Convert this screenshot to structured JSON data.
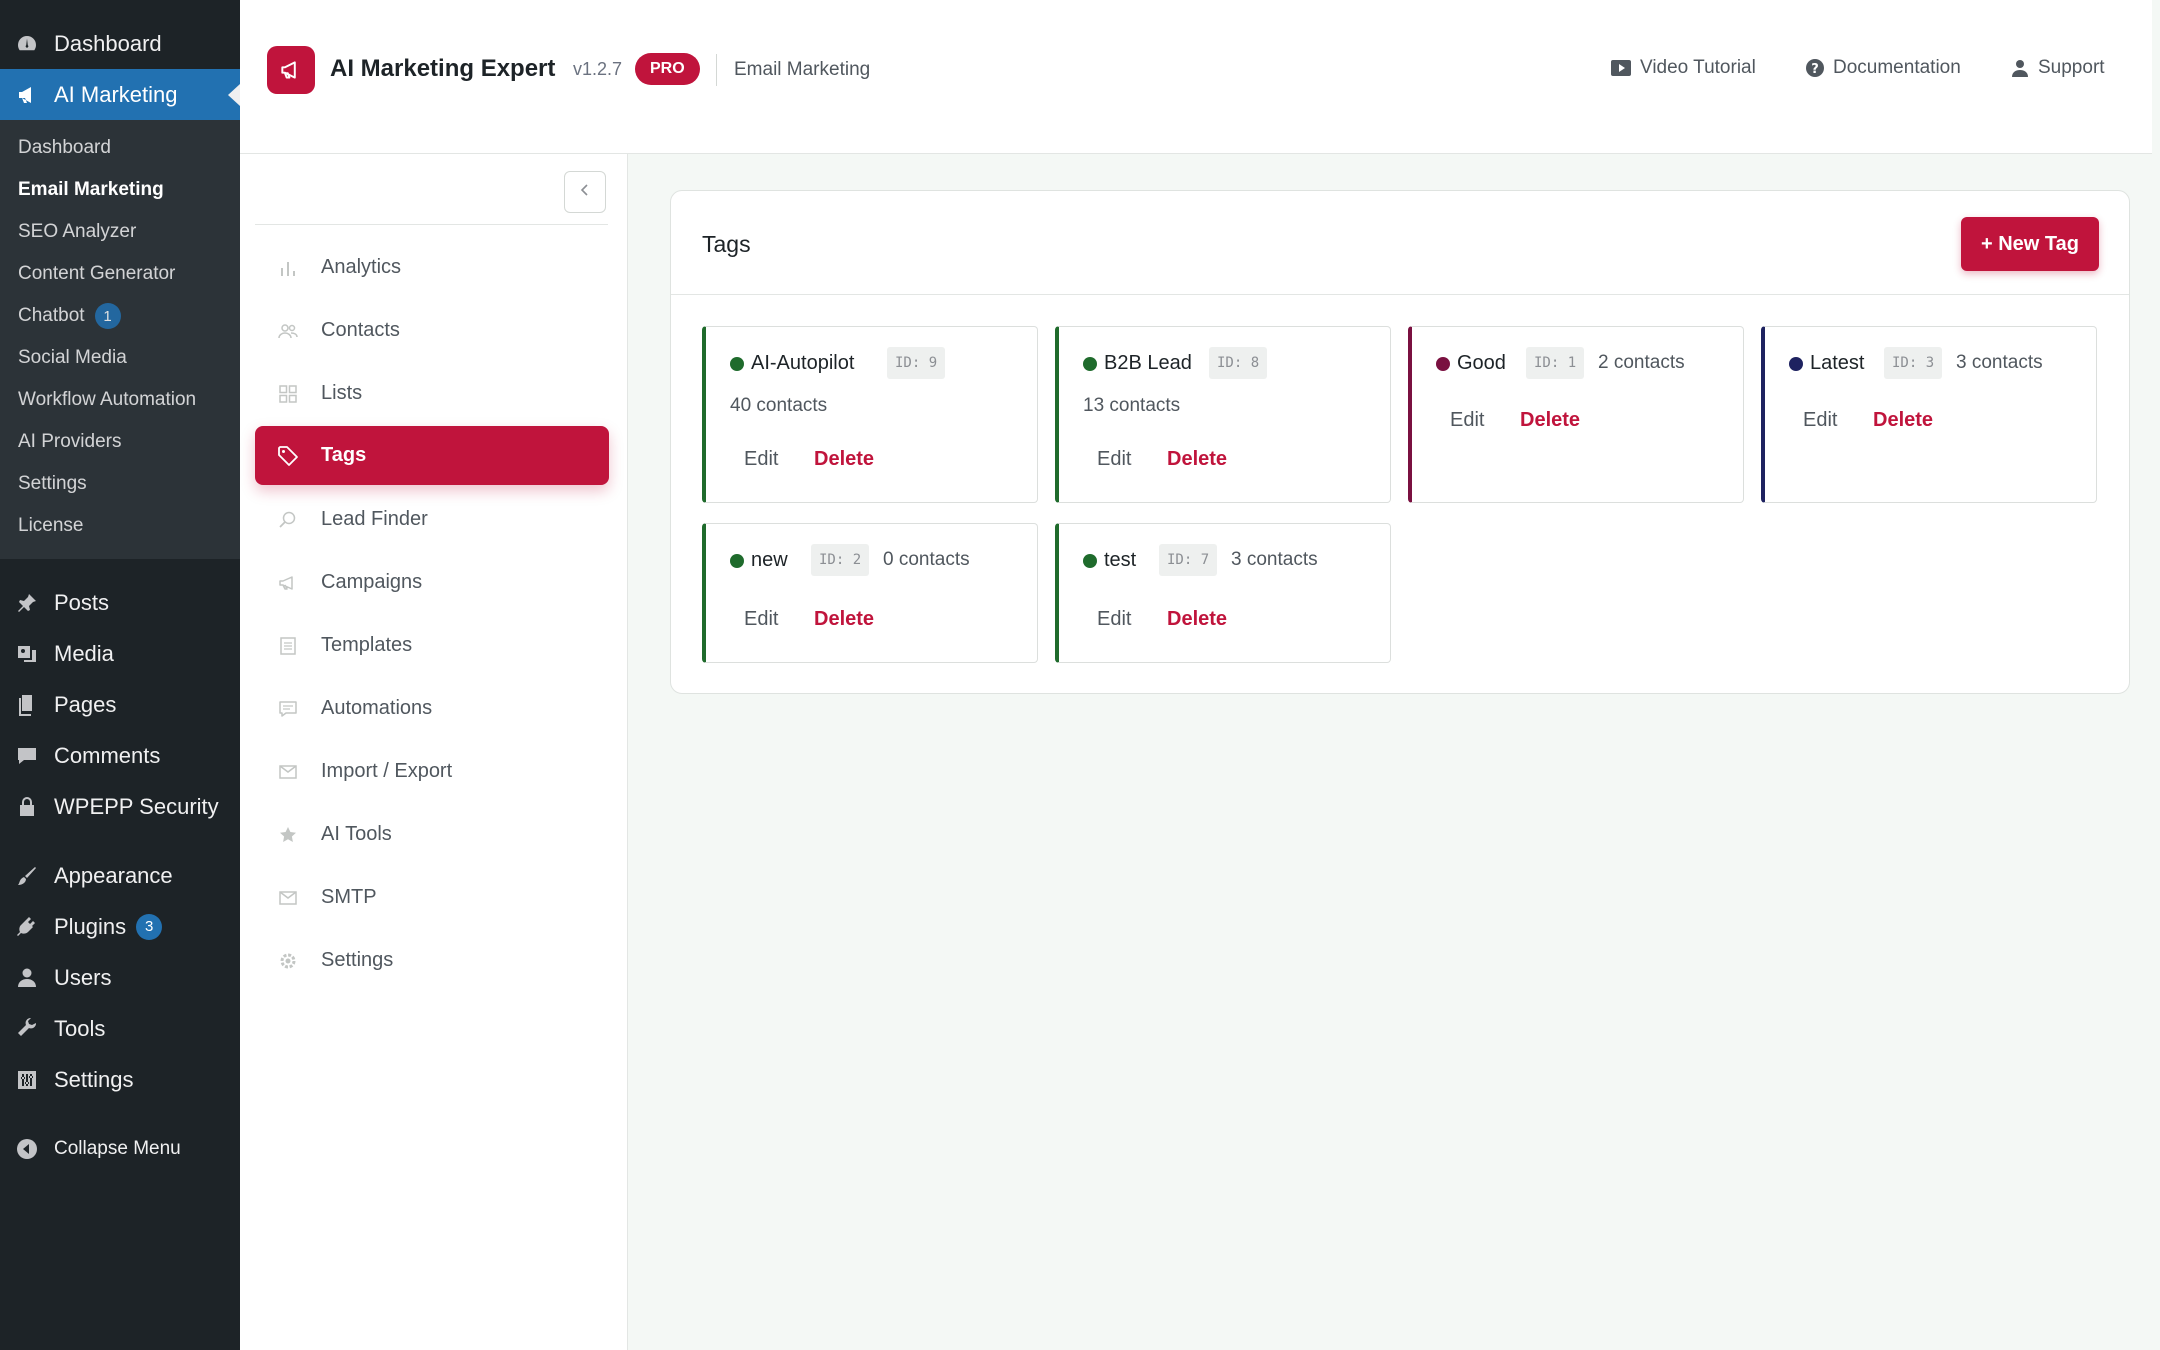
{
  "wp_menu": {
    "dashboard": "Dashboard",
    "ai_marketing": "AI Marketing",
    "submenu": [
      {
        "label": "Dashboard",
        "current": false
      },
      {
        "label": "Email Marketing",
        "current": true
      },
      {
        "label": "SEO Analyzer",
        "current": false
      },
      {
        "label": "Content Generator",
        "current": false
      },
      {
        "label": "Chatbot",
        "current": false,
        "badge": "1"
      },
      {
        "label": "Social Media",
        "current": false
      },
      {
        "label": "Workflow Automation",
        "current": false
      },
      {
        "label": "AI Providers",
        "current": false
      },
      {
        "label": "Settings",
        "current": false
      },
      {
        "label": "License",
        "current": false
      }
    ],
    "posts": "Posts",
    "media": "Media",
    "pages": "Pages",
    "comments": "Comments",
    "wpepp": "WPEPP Security",
    "appearance": "Appearance",
    "plugins": "Plugins",
    "plugins_badge": "3",
    "users": "Users",
    "tools": "Tools",
    "settings": "Settings",
    "collapse": "Collapse Menu"
  },
  "header": {
    "title": "AI Marketing Expert",
    "version": "v1.2.7",
    "pro": "PRO",
    "section": "Email Marketing",
    "links": {
      "video": "Video Tutorial",
      "docs": "Documentation",
      "support": "Support"
    }
  },
  "nav": {
    "items": [
      {
        "label": "Analytics",
        "icon": "bar-chart-icon"
      },
      {
        "label": "Contacts",
        "icon": "users-icon"
      },
      {
        "label": "Lists",
        "icon": "grid-icon"
      },
      {
        "label": "Tags",
        "icon": "tag-icon",
        "active": true
      },
      {
        "label": "Lead Finder",
        "icon": "search-icon"
      },
      {
        "label": "Campaigns",
        "icon": "megaphone-icon"
      },
      {
        "label": "Templates",
        "icon": "document-icon"
      },
      {
        "label": "Automations",
        "icon": "message-icon"
      },
      {
        "label": "Import / Export",
        "icon": "envelope-icon"
      },
      {
        "label": "AI Tools",
        "icon": "star-icon"
      },
      {
        "label": "SMTP",
        "icon": "envelope-icon"
      },
      {
        "label": "Settings",
        "icon": "gear-icon"
      }
    ]
  },
  "main": {
    "title": "Tags",
    "new_button": "+ New Tag",
    "edit_label": "Edit",
    "delete_label": "Delete",
    "tags": [
      {
        "name": "AI-Autopilot",
        "id": "ID: 9",
        "contacts": "40 contacts",
        "color": "#1f6b2c"
      },
      {
        "name": "B2B Lead",
        "id": "ID: 8",
        "contacts": "13 contacts",
        "color": "#1f6b2c"
      },
      {
        "name": "Good",
        "id": "ID: 1",
        "contacts": "2 contacts",
        "color": "#7a1040"
      },
      {
        "name": "Latest",
        "id": "ID: 3",
        "contacts": "3 contacts",
        "color": "#1e2260"
      },
      {
        "name": "new",
        "id": "ID: 2",
        "contacts": "0 contacts",
        "color": "#1f6b2c"
      },
      {
        "name": "test",
        "id": "ID: 7",
        "contacts": "3 contacts",
        "color": "#1f6b2c"
      }
    ]
  },
  "colors": {
    "accent": "#c0143c",
    "wp_admin_blue": "#2271b1",
    "wp_admin_dark": "#1d2327"
  }
}
